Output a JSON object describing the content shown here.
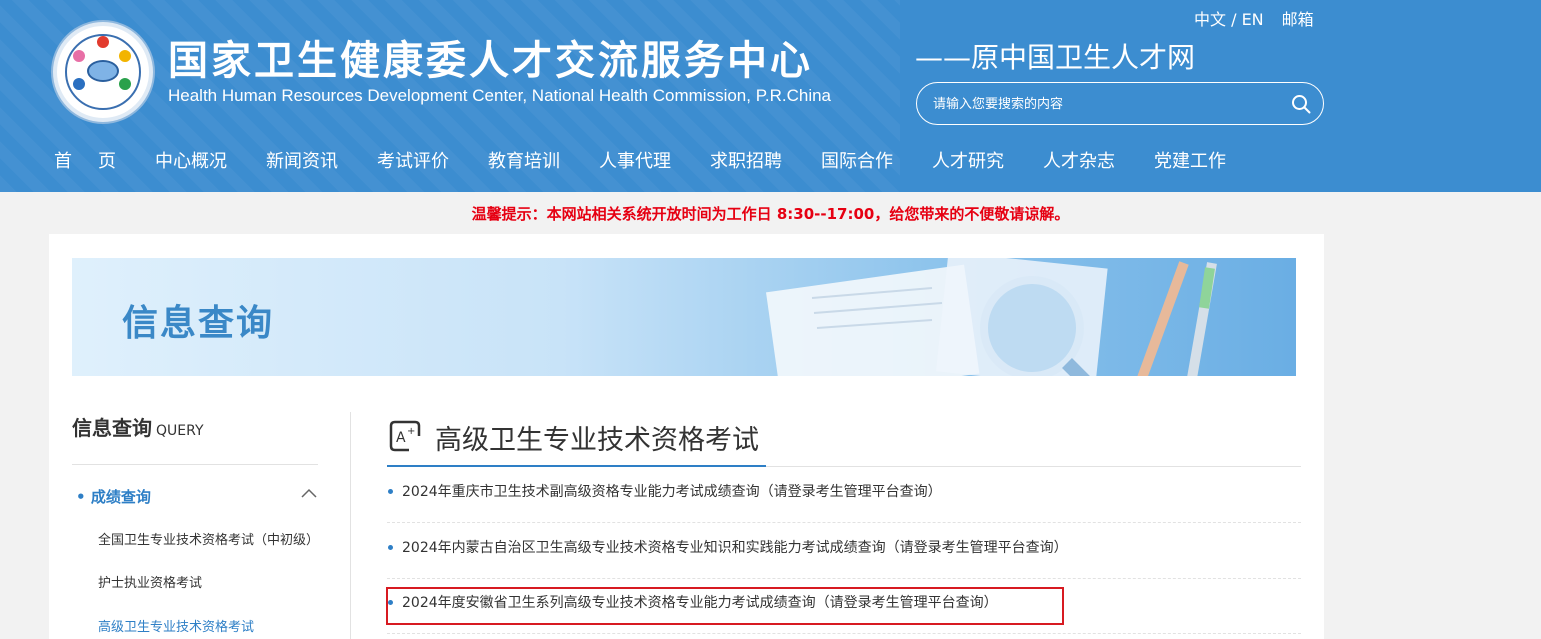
{
  "header": {
    "org_name_cn": "国家卫生健康委人才交流服务中心",
    "org_name_en": "Health Human Resources Development Center, National Health Commission, P.R.China",
    "subtitle": "——原中国卫生人才网",
    "lang_switch": "中文 / EN",
    "mail": "邮箱",
    "search_placeholder": "请输入您要搜索的内容",
    "logo_icon": "organization-logo",
    "search_icon": "search-icon"
  },
  "nav": {
    "items": [
      "首页",
      "中心概况",
      "新闻资讯",
      "考试评价",
      "教育培训",
      "人事代理",
      "求职招聘",
      "国际合作",
      "人才研究",
      "人才杂志",
      "党建工作"
    ]
  },
  "notice": "温馨提示：本网站相关系统开放时间为工作日 8:30--17:00，给您带来的不便敬请谅解。",
  "banner": {
    "title": "信息查询"
  },
  "sidebar": {
    "title": "信息查询",
    "title_en": "QUERY",
    "category": "成绩查询",
    "subitems": [
      "全国卫生专业技术资格考试（中初级）",
      "护士执业资格考试",
      "高级卫生专业技术资格考试"
    ]
  },
  "content": {
    "title": "高级卫生专业技术资格考试",
    "items": [
      "2024年重庆市卫生技术副高级资格专业能力考试成绩查询（请登录考生管理平台查询）",
      "2024年内蒙古自治区卫生高级专业技术资格专业知识和实践能力考试成绩查询（请登录考生管理平台查询）",
      "2024年度安徽省卫生系列高级专业技术资格专业能力考试成绩查询（请登录考生管理平台查询）"
    ]
  },
  "colors": {
    "header_bg": "#3c8dd0",
    "accent": "#2e7fc6",
    "notice": "#e60012",
    "highlight_box": "#d71a21"
  }
}
